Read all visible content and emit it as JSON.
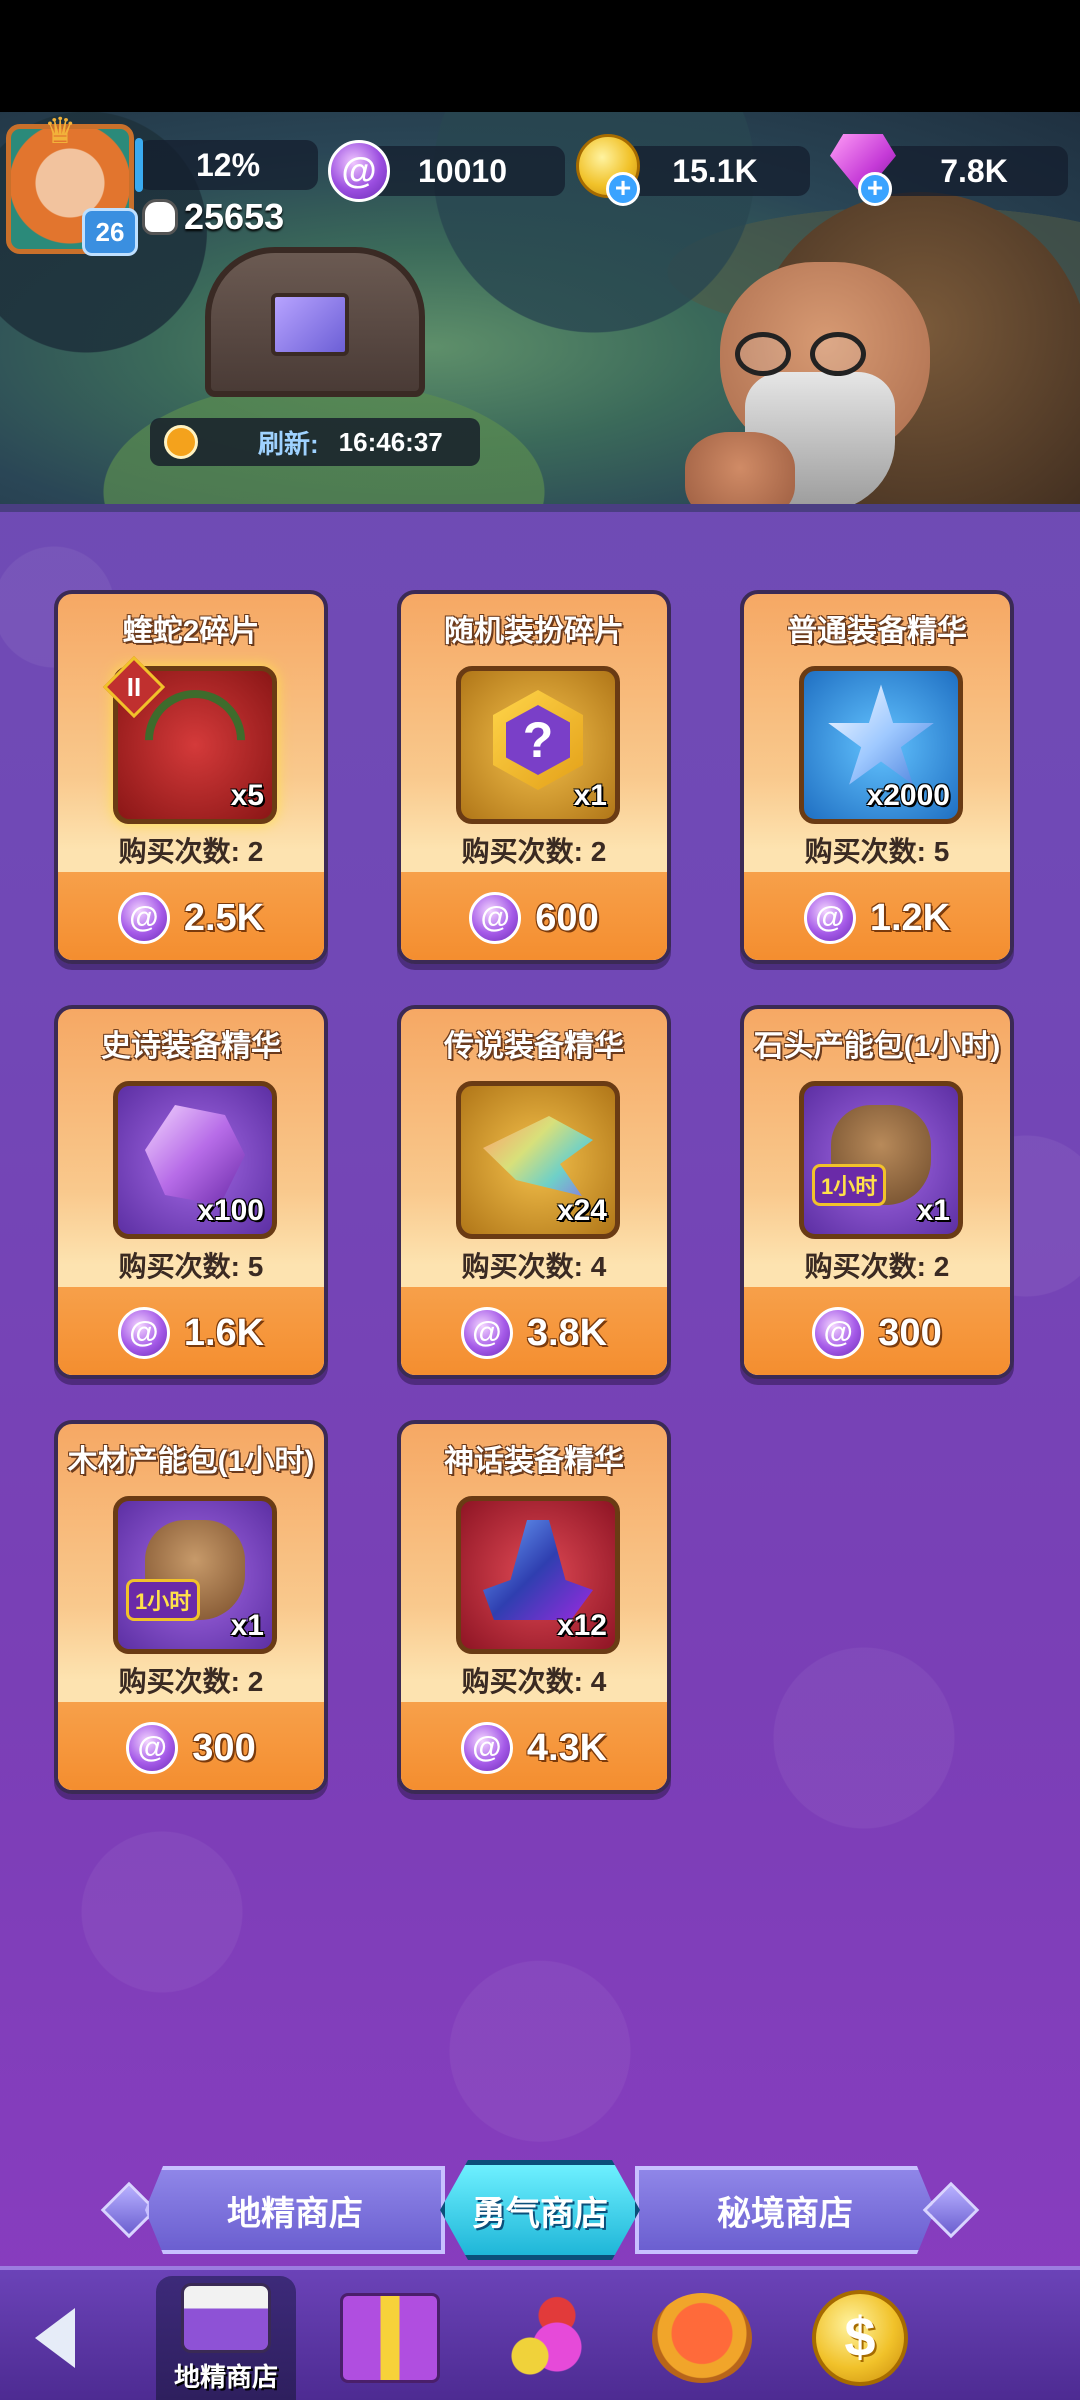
{
  "header": {
    "exp_percent": "12%",
    "player_level": "26",
    "power": "25653",
    "currencies": {
      "courage_points": "10010",
      "gold": "15.1K",
      "gems": "7.8K"
    },
    "refresh_label": "刷新:",
    "refresh_time": "16:46:37"
  },
  "cards": [
    {
      "title": "蝰蛇2碎片",
      "qty": "x5",
      "buys": "购买次数: 2",
      "price": "2.5K"
    },
    {
      "title": "随机装扮碎片",
      "qty": "x1",
      "buys": "购买次数: 2",
      "price": "600"
    },
    {
      "title": "普通装备精华",
      "qty": "x2000",
      "buys": "购买次数: 5",
      "price": "1.2K"
    },
    {
      "title": "史诗装备精华",
      "qty": "x100",
      "buys": "购买次数: 5",
      "price": "1.6K"
    },
    {
      "title": "传说装备精华",
      "qty": "x24",
      "buys": "购买次数: 4",
      "price": "3.8K"
    },
    {
      "title": "石头产能包(1小时)",
      "qty": "x1",
      "buys": "购买次数: 2",
      "price": "300",
      "tag": "1小时"
    },
    {
      "title": "木材产能包(1小时)",
      "qty": "x1",
      "buys": "购买次数: 2",
      "price": "300",
      "tag": "1小时"
    },
    {
      "title": "神话装备精华",
      "qty": "x12",
      "buys": "购买次数: 4",
      "price": "4.3K"
    }
  ],
  "roman_badge": "II",
  "shop_tabs": {
    "left": "地精商店",
    "active": "勇气商店",
    "right": "秘境商店"
  },
  "bottom_nav": {
    "active_label": "地精商店",
    "coin_symbol": "$"
  },
  "colors": {
    "background": "#7148b6",
    "card": "#f6a864",
    "active_tab": "#1fb6d8"
  }
}
